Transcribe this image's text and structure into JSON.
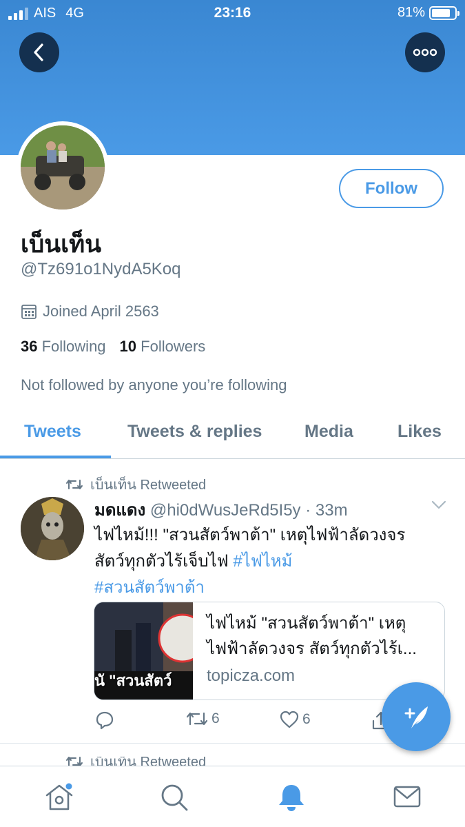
{
  "status_bar": {
    "carrier": "AIS",
    "network": "4G",
    "time": "23:16",
    "battery": "81%",
    "battery_level": 0.81
  },
  "profile": {
    "display_name": "เบ็นเท็น",
    "handle": "@Tz691o1NydA5Koq",
    "joined": "Joined April 2563",
    "following_count": "36",
    "following_label": "Following",
    "followers_count": "10",
    "followers_label": "Followers",
    "not_followed": "Not followed by anyone you’re following",
    "follow_label": "Follow"
  },
  "tabs": [
    {
      "label": "Tweets",
      "active": true
    },
    {
      "label": "Tweets & replies",
      "active": false
    },
    {
      "label": "Media",
      "active": false
    },
    {
      "label": "Likes",
      "active": false
    }
  ],
  "tweet": {
    "retweet_label": "เบ็นเท็น Retweeted",
    "author_name": "มดแดง",
    "author_meta": "@hi0dWusJeRd5I5y · 33m",
    "text_line1": "ไฟไหม้!!! \"สวนสัตว์พาต้า\" เหตุไฟฟ้าลัดวงจร",
    "text_line2_plain": "สัตว์ทุกตัวไร้เจ็บไฟ ",
    "hashtag1": "#ไฟไหม้",
    "hashtag2": "#สวนสัตว์พาต้า",
    "card_title": "ไฟไหม้ \"สวนสัตว์พาต้า\" เหตุไฟฟ้าลัดวงจร สัตว์ทุกตัวไร้เ...",
    "card_image_text": "นั \"สวนสัตว์",
    "card_domain": "topicza.com",
    "retweets": "6",
    "likes": "6"
  },
  "next_retweet_label": "เบ็นเท็น Retweeted",
  "colors": {
    "accent": "#4a9ae6",
    "banner": "#3a87d2",
    "dark_button": "#14304f",
    "muted": "#657786"
  },
  "icons": [
    "back-icon",
    "more-icon",
    "calendar-icon",
    "retweet-icon",
    "chevron-down-icon",
    "reply-icon",
    "like-icon",
    "share-icon",
    "compose-icon",
    "home-icon",
    "search-icon",
    "notifications-icon",
    "messages-icon"
  ]
}
